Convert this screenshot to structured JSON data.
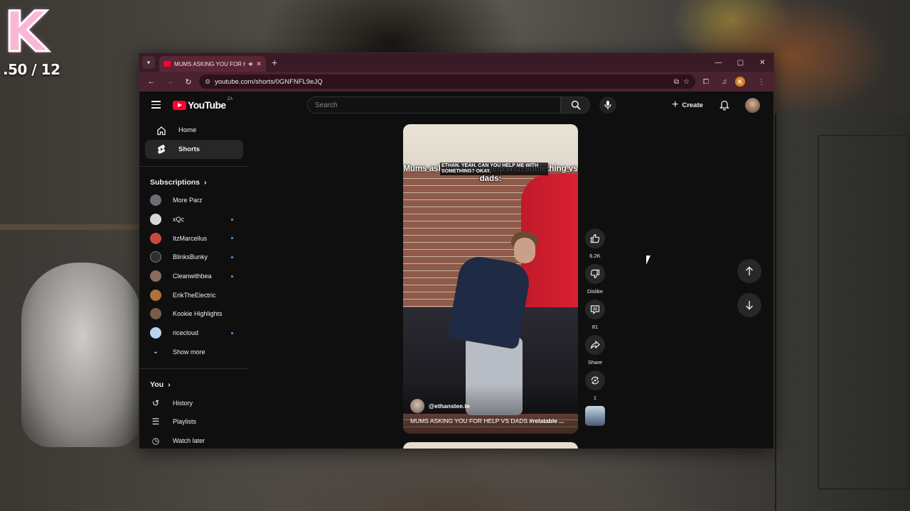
{
  "stream_overlay": {
    "logo_letter": "K",
    "counter": ".50 / 12"
  },
  "browser": {
    "tab_title": "MUMS ASKING YOU FOR HELP VS DADS",
    "url": "youtube.com/shorts/0GNFNFL9eJQ",
    "profile_initial": "K"
  },
  "youtube": {
    "logo_text": "YouTube",
    "country_code": "ZA",
    "search_placeholder": "Search",
    "create_label": "Create",
    "sidebar": {
      "home": "Home",
      "shorts": "Shorts",
      "subscriptions_header": "Subscriptions",
      "subscriptions": [
        {
          "name": "More Parz",
          "color": "#6b6f74",
          "new": false
        },
        {
          "name": "xQc",
          "color": "#d8d8d8",
          "new": true
        },
        {
          "name": "ItzMarcellus",
          "color": "#c9483c",
          "new": true
        },
        {
          "name": "BlinksBunky",
          "color": "#2e2e2e",
          "new": true
        },
        {
          "name": "Cleanwithbea",
          "color": "#8a6a5a",
          "new": true
        },
        {
          "name": "ErikTheElectric",
          "color": "#b0703a",
          "new": false
        },
        {
          "name": "Kookie Highlights",
          "color": "#7a5a48",
          "new": false
        },
        {
          "name": "ricecloud",
          "color": "#b8d4f0",
          "new": true
        }
      ],
      "show_more": "Show more",
      "you_header": "You",
      "you_items": [
        "History",
        "Playlists",
        "Watch later"
      ]
    },
    "short": {
      "caption_main": "Mums asking you for help with something vs dads:",
      "caption_overlay": "ETHAN. YEAH. CAN YOU HELP ME WITH SOMETHING? OKAY.",
      "channel": "@ethanstee.te",
      "description_text": "MUMS ASKING YOU FOR HELP VS DADS ",
      "description_tag": "#relatable ...",
      "likes": "6.2K",
      "dislike_label": "Dislike",
      "comments": "81",
      "share_label": "Share",
      "remix_count": "1"
    }
  }
}
